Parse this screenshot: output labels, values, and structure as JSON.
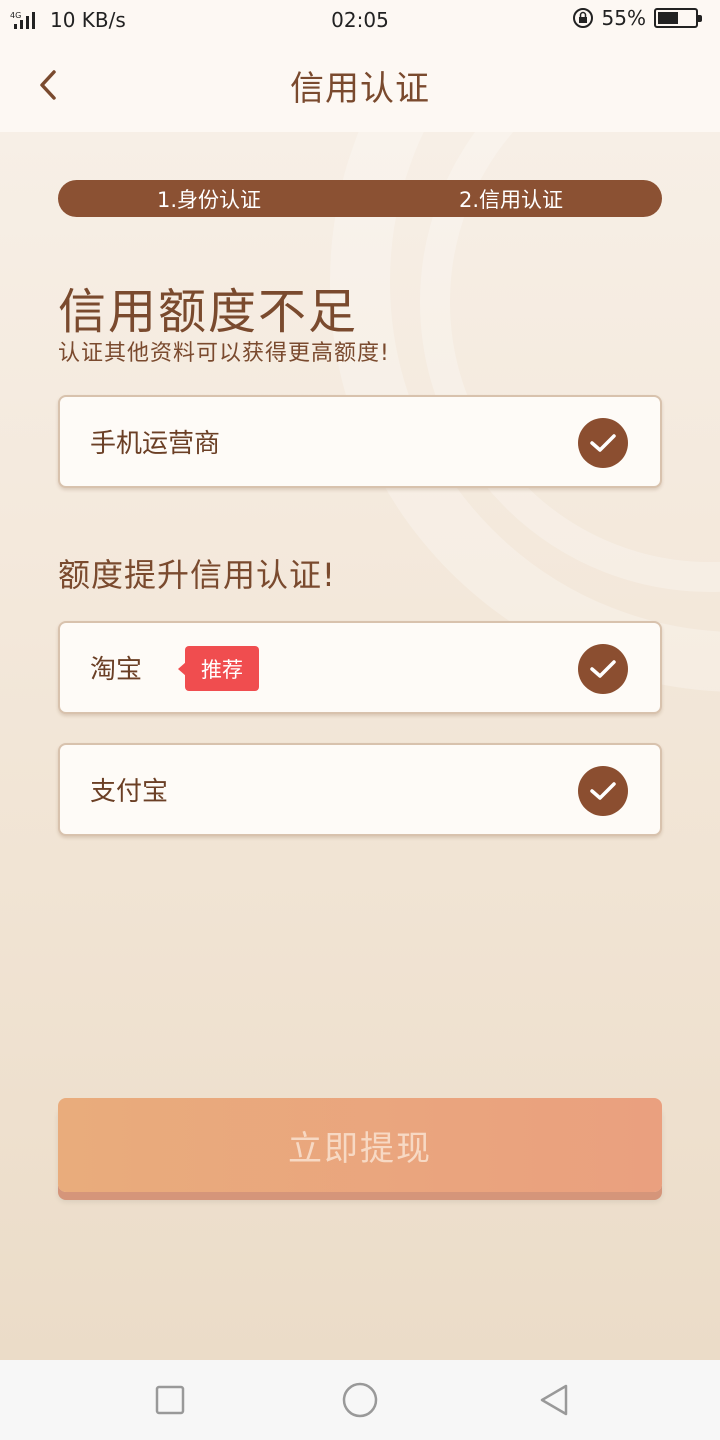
{
  "status_bar": {
    "signal_icon": "signal-4g-icon",
    "speed": "10 KB/s",
    "time": "02:05",
    "battery_percent": "55%",
    "battery_level": 0.55
  },
  "header": {
    "title": "信用认证",
    "back_icon": "chevron-left-icon"
  },
  "steps": [
    {
      "label": "1.身份认证"
    },
    {
      "label": "2.信用认证"
    }
  ],
  "main": {
    "heading": "信用额度不足",
    "subheading": "认证其他资料可以获得更高额度!",
    "section_title": "额度提升信用认证!",
    "cards": [
      {
        "label": "手机运营商",
        "checked": true
      },
      {
        "label": "淘宝",
        "badge": "推荐",
        "checked": true
      },
      {
        "label": "支付宝",
        "checked": true
      }
    ],
    "submit_label": "立即提现"
  },
  "colors": {
    "brand": "#8b5133",
    "badge": "#f04d4f",
    "button": "#e9ac7c"
  }
}
